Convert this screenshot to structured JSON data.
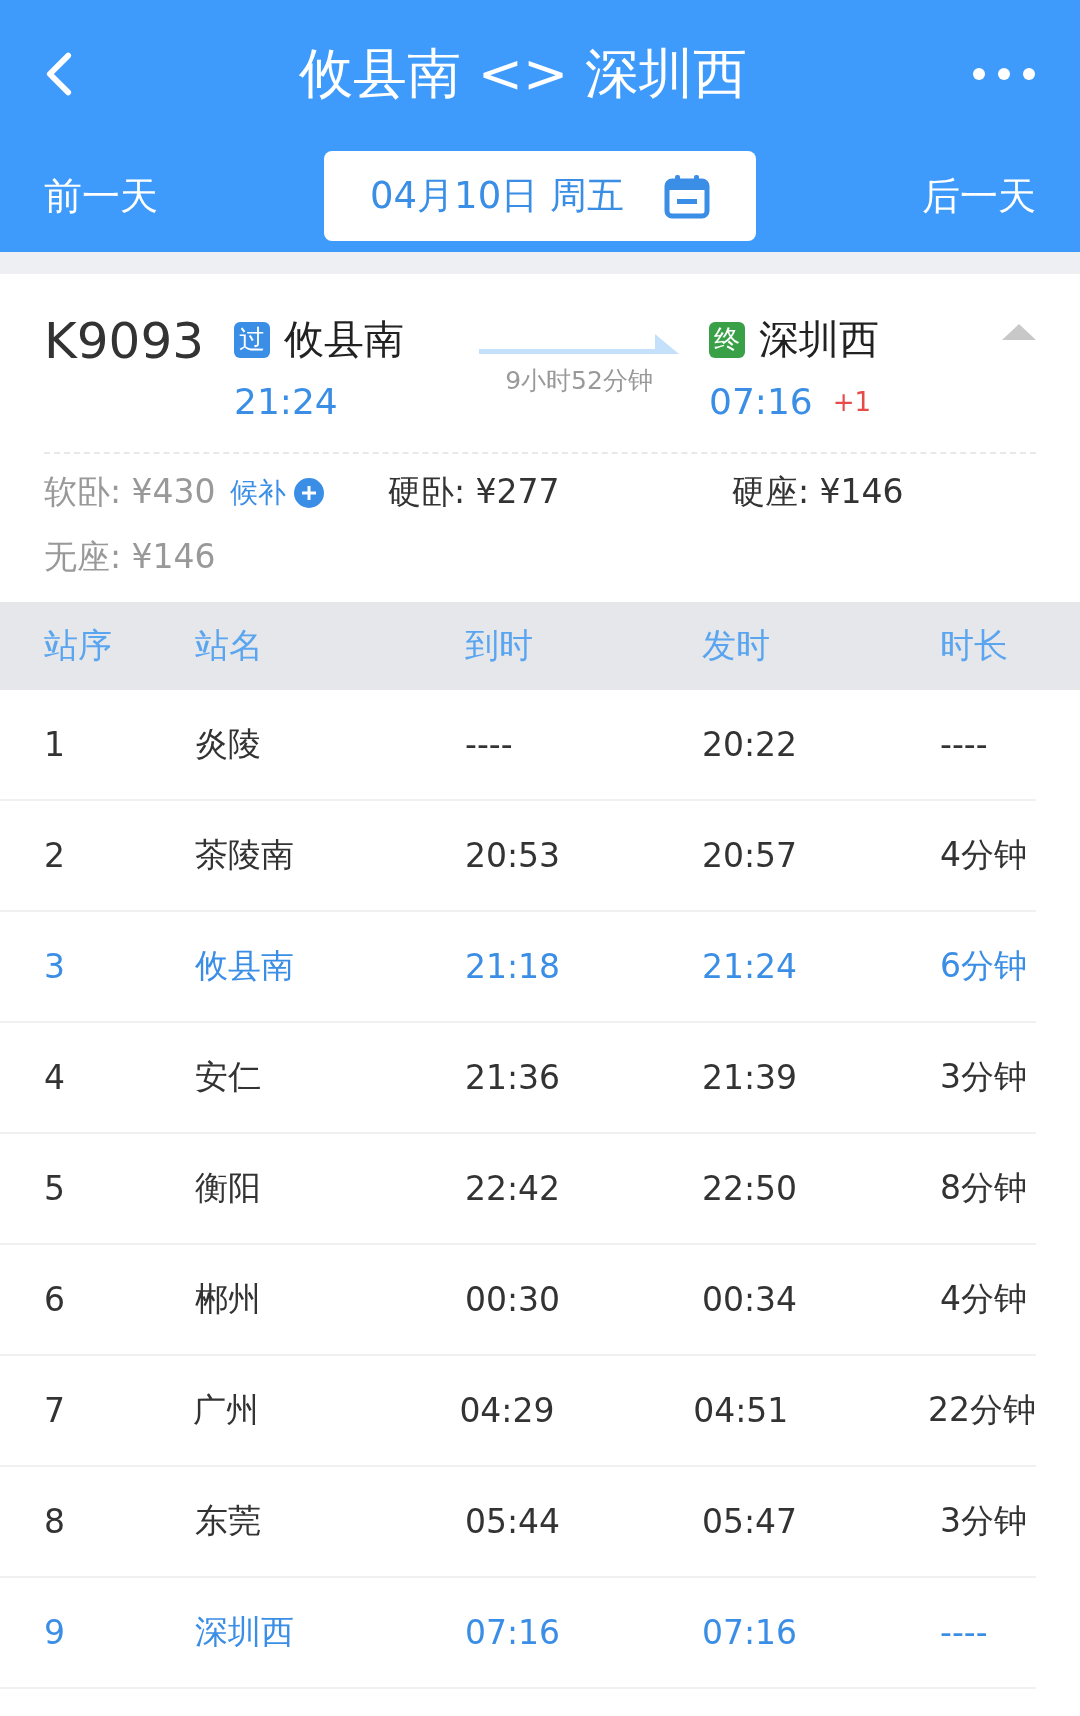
{
  "header": {
    "title": "攸县南 <> 深圳西",
    "prev_day": "前一天",
    "date": "04月10日 周五",
    "next_day": "后一天"
  },
  "train": {
    "number": "K9093",
    "expanded": true,
    "from": {
      "badge": "过",
      "color": "#3a8ee6",
      "station": "攸县南",
      "time": "21:24"
    },
    "duration": "9小时52分钟",
    "to": {
      "badge": "终",
      "color": "#3aa047",
      "station": "深圳西",
      "time": "07:16",
      "day_offset": "+1"
    }
  },
  "prices": [
    {
      "label": "软卧: ¥430",
      "available": false,
      "waitlist": "候补"
    },
    {
      "label": "硬卧: ¥277",
      "available": true
    },
    {
      "label": "硬座: ¥146",
      "available": true
    },
    {
      "label": "无座: ¥146",
      "available": false
    }
  ],
  "table": {
    "columns": [
      "站序",
      "站名",
      "到时",
      "发时",
      "时长"
    ],
    "rows": [
      {
        "cells": [
          "1",
          "炎陵",
          "----",
          "20:22",
          "----"
        ],
        "highlighted": false
      },
      {
        "cells": [
          "2",
          "茶陵南",
          "20:53",
          "20:57",
          "4分钟"
        ],
        "highlighted": false
      },
      {
        "cells": [
          "3",
          "攸县南",
          "21:18",
          "21:24",
          "6分钟"
        ],
        "highlighted": true
      },
      {
        "cells": [
          "4",
          "安仁",
          "21:36",
          "21:39",
          "3分钟"
        ],
        "highlighted": false
      },
      {
        "cells": [
          "5",
          "衡阳",
          "22:42",
          "22:50",
          "8分钟"
        ],
        "highlighted": false
      },
      {
        "cells": [
          "6",
          "郴州",
          "00:30",
          "00:34",
          "4分钟"
        ],
        "highlighted": false
      },
      {
        "cells": [
          "7",
          "广州",
          "04:29",
          "04:51",
          "22分钟"
        ],
        "highlighted": false
      },
      {
        "cells": [
          "8",
          "东莞",
          "05:44",
          "05:47",
          "3分钟"
        ],
        "highlighted": false
      },
      {
        "cells": [
          "9",
          "深圳西",
          "07:16",
          "07:16",
          "----"
        ],
        "highlighted": true
      }
    ]
  }
}
